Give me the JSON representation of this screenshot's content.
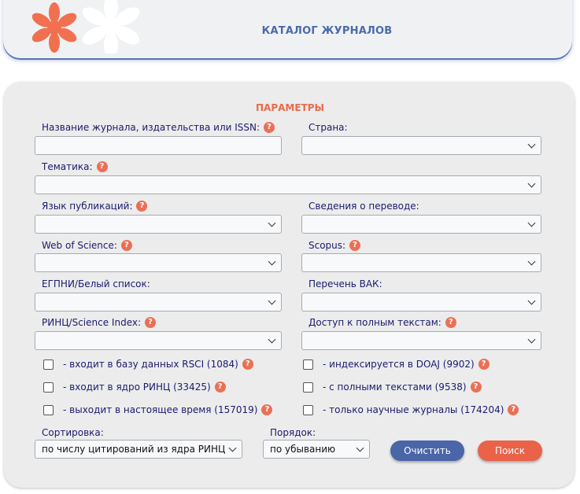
{
  "header": {
    "title": "КАТАЛОГ ЖУРНАЛОВ"
  },
  "params": {
    "title": "ПАРАМЕТРЫ",
    "help_glyph": "?",
    "journal_name_label": "Название журнала, издательства или ISSN:",
    "journal_name_value": "",
    "country_label": "Страна:",
    "country_value": "",
    "subject_label": "Тематика:",
    "subject_value": "",
    "language_label": "Язык публикаций:",
    "language_value": "",
    "translation_label": "Сведения о переводе:",
    "translation_value": "",
    "wos_label": "Web of Science:",
    "wos_value": "",
    "scopus_label": "Scopus:",
    "scopus_value": "",
    "egpni_label": "ЕГПНИ/Белый список:",
    "egpni_value": "",
    "vak_label": "Перечень ВАК:",
    "vak_value": "",
    "rinc_label": "РИНЦ/Science Index:",
    "rinc_value": "",
    "fulltext_access_label": "Доступ к полным текстам:",
    "fulltext_access_value": ""
  },
  "checkboxes": {
    "rsci": "- входит в базу данных RSCI (1084)",
    "rinc_core": "- входит в ядро РИНЦ (33425)",
    "current": "- выходит в настоящее время (157019)",
    "doaj": "- индексируется в DOAJ (9902)",
    "fulltext": "- с полными текстами (9538)",
    "scientific": "- только научные журналы (174204)"
  },
  "sort": {
    "label": "Сортировка:",
    "value": "по числу цитирований из ядра РИНЦ",
    "order_label": "Порядок:",
    "order_value": "по убыванию"
  },
  "buttons": {
    "clear": "Очистить",
    "search": "Поиск"
  },
  "colors": {
    "accent": "#ea6a4a",
    "brand_blue": "#4a6aaa",
    "panel_bg": "#ececec"
  }
}
